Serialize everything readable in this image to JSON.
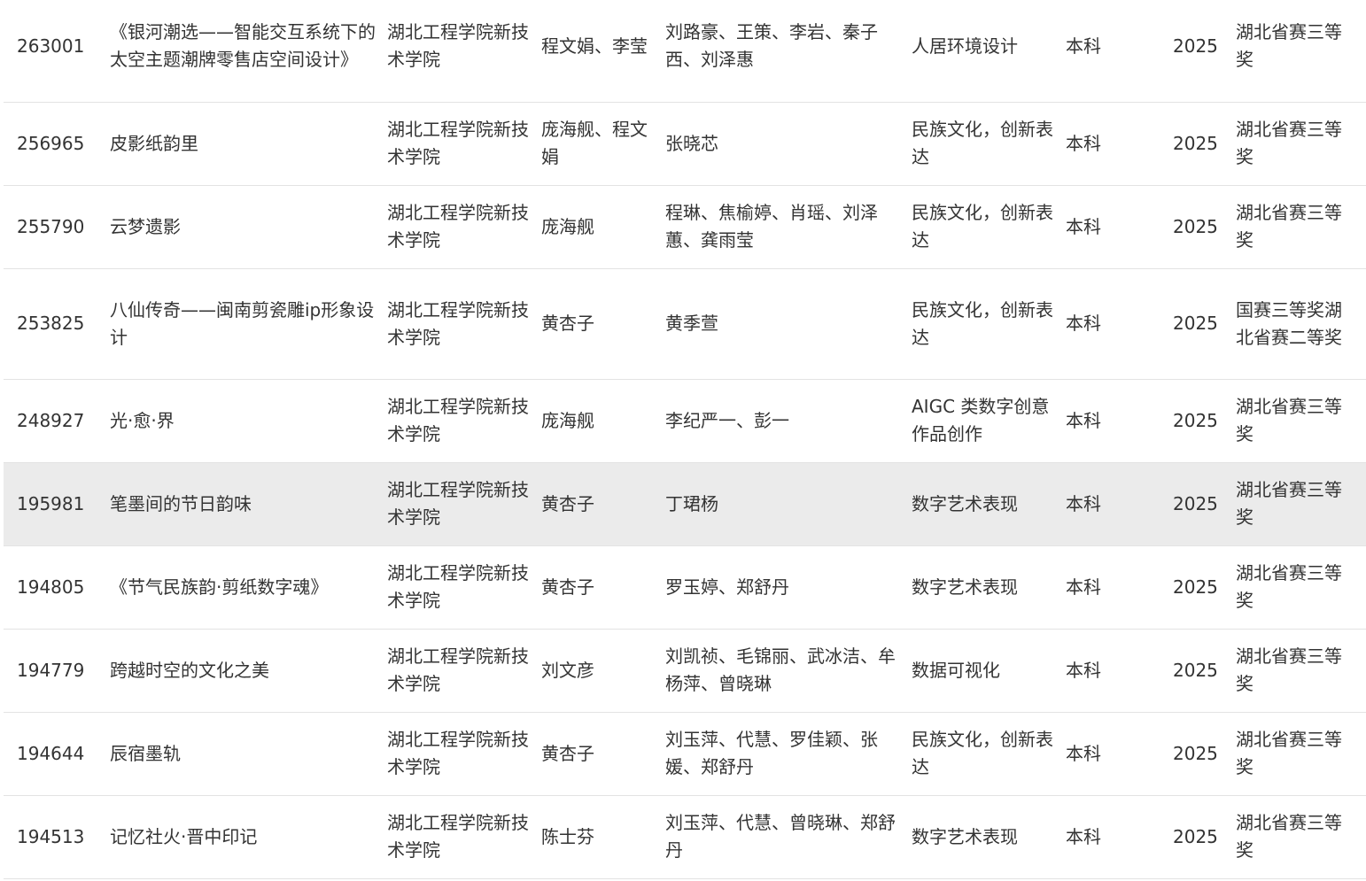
{
  "table": {
    "rows": [
      {
        "id": "263001",
        "work": "《银河潮选——智能交互系统下的太空主题潮牌零售店空间设计》",
        "school": "湖北工程学院新技术学院",
        "advisor": "程文娟、李莹",
        "students": "刘路豪、王策、李岩、秦子西、刘泽惠",
        "category": "人居环境设计",
        "level": "本科",
        "year": "2025",
        "award": "湖北省赛三等奖"
      },
      {
        "id": "256965",
        "work": "皮影纸韵里",
        "school": "湖北工程学院新技术学院",
        "advisor": "庞海舰、程文娟",
        "students": "张晓芯",
        "category": "民族文化，创新表达",
        "level": "本科",
        "year": "2025",
        "award": "湖北省赛三等奖"
      },
      {
        "id": "255790",
        "work": "云梦遗影",
        "school": "湖北工程学院新技术学院",
        "advisor": "庞海舰",
        "students": "程琳、焦榆婷、肖瑶、刘泽蕙、龚雨莹",
        "category": "民族文化，创新表达",
        "level": "本科",
        "year": "2025",
        "award": "湖北省赛三等奖"
      },
      {
        "id": "253825",
        "work": "八仙传奇——闽南剪瓷雕ip形象设计",
        "school": "湖北工程学院新技术学院",
        "advisor": "黄杏子",
        "students": "黄季萱",
        "category": "民族文化，创新表达",
        "level": "本科",
        "year": "2025",
        "award": "国赛三等奖湖北省赛二等奖"
      },
      {
        "id": "248927",
        "work": "光·愈·界",
        "school": "湖北工程学院新技术学院",
        "advisor": "庞海舰",
        "students": "李纪严一、彭一",
        "category": "AIGC 类数字创意作品创作",
        "level": "本科",
        "year": "2025",
        "award": "湖北省赛三等奖"
      },
      {
        "id": "195981",
        "work": "笔墨间的节日韵味",
        "school": "湖北工程学院新技术学院",
        "advisor": "黄杏子",
        "students": "丁珺杨",
        "category": "数字艺术表现",
        "level": "本科",
        "year": "2025",
        "award": "湖北省赛三等奖"
      },
      {
        "id": "194805",
        "work": "《节气民族韵·剪纸数字魂》",
        "school": "湖北工程学院新技术学院",
        "advisor": "黄杏子",
        "students": "罗玉婷、郑舒丹",
        "category": "数字艺术表现",
        "level": "本科",
        "year": "2025",
        "award": "湖北省赛三等奖"
      },
      {
        "id": "194779",
        "work": "跨越时空的文化之美",
        "school": "湖北工程学院新技术学院",
        "advisor": "刘文彦",
        "students": "刘凯祯、毛锦丽、武冰洁、牟杨萍、曾晓琳",
        "category": "数据可视化",
        "level": "本科",
        "year": "2025",
        "award": "湖北省赛三等奖"
      },
      {
        "id": "194644",
        "work": "辰宿墨轨",
        "school": "湖北工程学院新技术学院",
        "advisor": "黄杏子",
        "students": "刘玉萍、代慧、罗佳颖、张媛、郑舒丹",
        "category": "民族文化，创新表达",
        "level": "本科",
        "year": "2025",
        "award": "湖北省赛三等奖"
      },
      {
        "id": "194513",
        "work": "记忆社火·晋中印记",
        "school": "湖北工程学院新技术学院",
        "advisor": "陈士芬",
        "students": "刘玉萍、代慧、曾晓琳、郑舒丹",
        "category": "数字艺术表现",
        "level": "本科",
        "year": "2025",
        "award": "湖北省赛三等奖"
      }
    ]
  }
}
